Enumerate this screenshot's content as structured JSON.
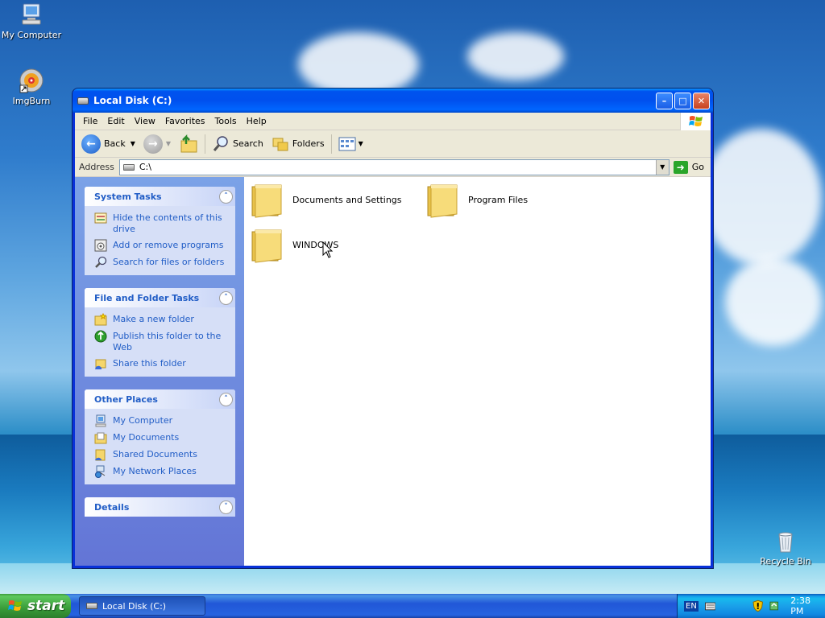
{
  "desktop": {
    "icons": [
      {
        "label": "My Computer",
        "icon": "my-computer-icon"
      },
      {
        "label": "ImgBurn",
        "icon": "imgburn-icon"
      },
      {
        "label": "Recycle Bin",
        "icon": "recycle-bin-icon"
      }
    ]
  },
  "window": {
    "title": "Local Disk (C:)",
    "menu": [
      "File",
      "Edit",
      "View",
      "Favorites",
      "Tools",
      "Help"
    ],
    "toolbar": {
      "back": "Back",
      "search": "Search",
      "folders": "Folders"
    },
    "address": {
      "label": "Address",
      "value": "C:\\",
      "go": "Go"
    },
    "panels": {
      "system_tasks": {
        "title": "System Tasks",
        "items": [
          "Hide the contents of this drive",
          "Add or remove programs",
          "Search for files or folders"
        ]
      },
      "file_folder_tasks": {
        "title": "File and Folder Tasks",
        "items": [
          "Make a new folder",
          "Publish this folder to the Web",
          "Share this folder"
        ]
      },
      "other_places": {
        "title": "Other Places",
        "items": [
          "My Computer",
          "My Documents",
          "Shared Documents",
          "My Network Places"
        ]
      },
      "details": {
        "title": "Details"
      }
    },
    "folders": [
      "Documents and Settings",
      "Program Files",
      "WINDOWS"
    ]
  },
  "taskbar": {
    "start": "start",
    "task": "Local Disk (C:)",
    "lang": "EN",
    "clock": "2:38 PM"
  }
}
